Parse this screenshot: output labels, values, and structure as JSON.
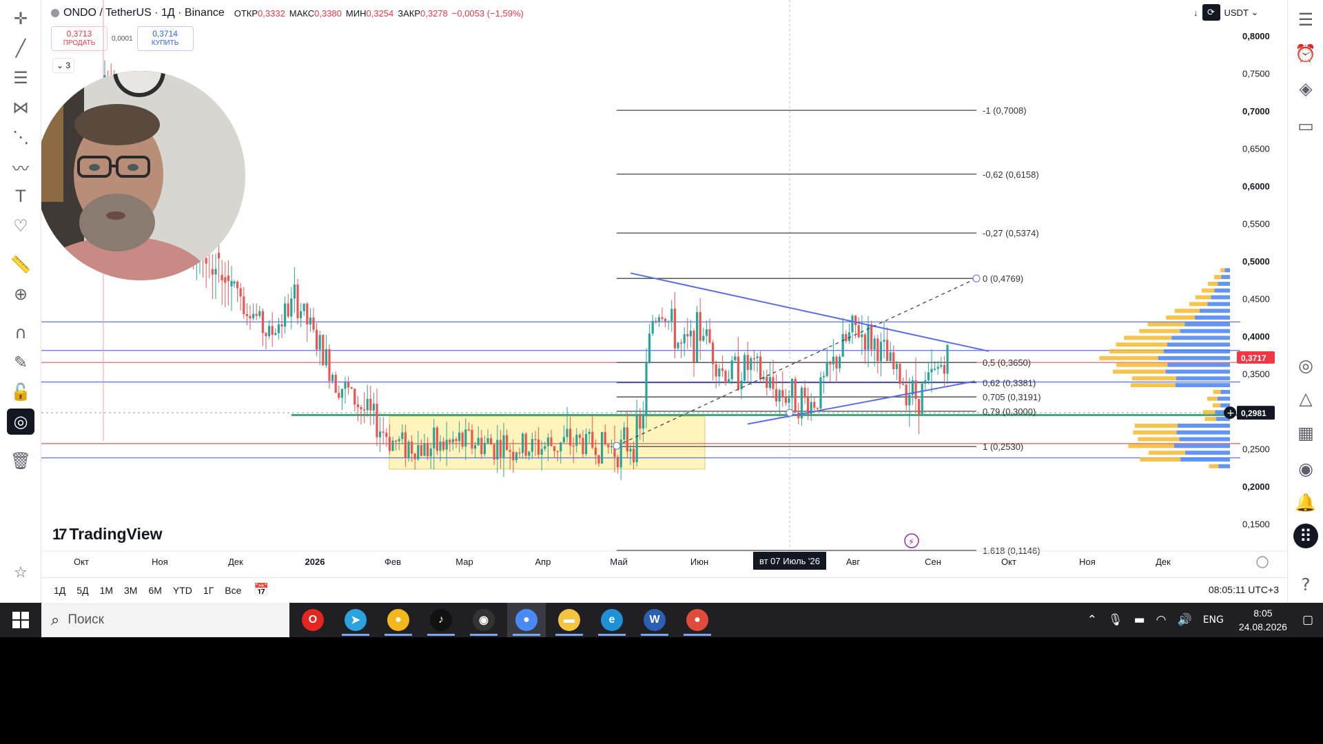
{
  "header": {
    "title": "ONDO / TetherUS · 1Д · Binance",
    "open_label": "ОТКР",
    "open": "0,3332",
    "high_label": "МАКС",
    "high": "0,3380",
    "low_label": "МИН",
    "low": "0,3254",
    "close_label": "ЗАКР",
    "close": "0,3278",
    "change": "−0,0053 (−1,59%)"
  },
  "trade": {
    "sell_price": "0,3713",
    "sell_label": "ПРОДАТЬ",
    "spread": "0,0001",
    "buy_price": "0,3714",
    "buy_label": "КУПИТЬ",
    "collapse": "3"
  },
  "top_right": {
    "currency": "USDT"
  },
  "logo": "TradingView",
  "chart_data": {
    "type": "candlestick",
    "symbol": "ONDO/USDT",
    "exchange": "Binance",
    "interval": "1Д",
    "ylim": [
      0.12,
      0.82
    ],
    "price_ticks": [
      "0,8000",
      "0,7500",
      "0,7000",
      "0,6500",
      "0,6000",
      "0,5500",
      "0,5000",
      "0,4500",
      "0,4000",
      "0,3500",
      "0,3000",
      "0,2500",
      "0,2000",
      "0,1500"
    ],
    "price_tick_values": [
      0.8,
      0.75,
      0.7,
      0.65,
      0.6,
      0.55,
      0.5,
      0.45,
      0.4,
      0.35,
      0.3,
      0.25,
      0.2,
      0.15
    ],
    "time_ticks": [
      "Окт",
      "Ноя",
      "Дек",
      "2026",
      "Фев",
      "Мар",
      "Апр",
      "Май",
      "Июн",
      "Июл",
      "Авг",
      "Сен",
      "Окт",
      "Ноя",
      "Дек"
    ],
    "crosshair_time_label": "вт 07 Июль '26",
    "current_price": "0,3717",
    "current_price_value": 0.3717,
    "cursor_price": "0,2981",
    "cursor_price_value": 0.2981,
    "fib_levels": [
      {
        "label": "-1 (0,7008)",
        "value": 0.7008
      },
      {
        "label": "-0,62 (0,6158)",
        "value": 0.6158
      },
      {
        "label": "-0,27 (0,5374)",
        "value": 0.5374
      },
      {
        "label": "0 (0,4769)",
        "value": 0.4769
      },
      {
        "label": "0,5 (0,3650)",
        "value": 0.365
      },
      {
        "label": "0,62 (0,3381)",
        "value": 0.3381
      },
      {
        "label": "0,705 (0,3191)",
        "value": 0.3191
      },
      {
        "label": "0,79 (0,3000)",
        "value": 0.3
      },
      {
        "label": "1 (0,2530)",
        "value": 0.253
      },
      {
        "label": "1.618 (0,1146)",
        "value": 0.1146
      }
    ],
    "horizontal_lines": [
      {
        "value": 0.419,
        "color": "#5b6ee1"
      },
      {
        "value": 0.381,
        "color": "#5b6ee1"
      },
      {
        "value": 0.365,
        "color": "#e06a6a"
      },
      {
        "value": 0.339,
        "color": "#5b6ee1"
      },
      {
        "value": 0.295,
        "color": "#2e9e6e"
      },
      {
        "value": 0.257,
        "color": "#e06a6a"
      },
      {
        "value": 0.238,
        "color": "#5b6ee1"
      }
    ],
    "colors": {
      "up": "#26a69a",
      "down": "#ef5350",
      "accent": "#2962ff",
      "zone": "#fff3b0"
    }
  },
  "bottom": {
    "ranges": [
      "1Д",
      "5Д",
      "1М",
      "3М",
      "6М",
      "YTD",
      "1Г",
      "Все"
    ],
    "clock": "08:05:11 UTC+3"
  },
  "taskbar": {
    "search_placeholder": "Поиск",
    "apps": [
      "opera",
      "telegram",
      "chrome",
      "tiktok",
      "obs",
      "chrome-profile",
      "file-explorer",
      "edge",
      "word",
      "chrome-alt"
    ],
    "lang": "ENG",
    "time": "8:05",
    "date": "24.08.2026"
  }
}
